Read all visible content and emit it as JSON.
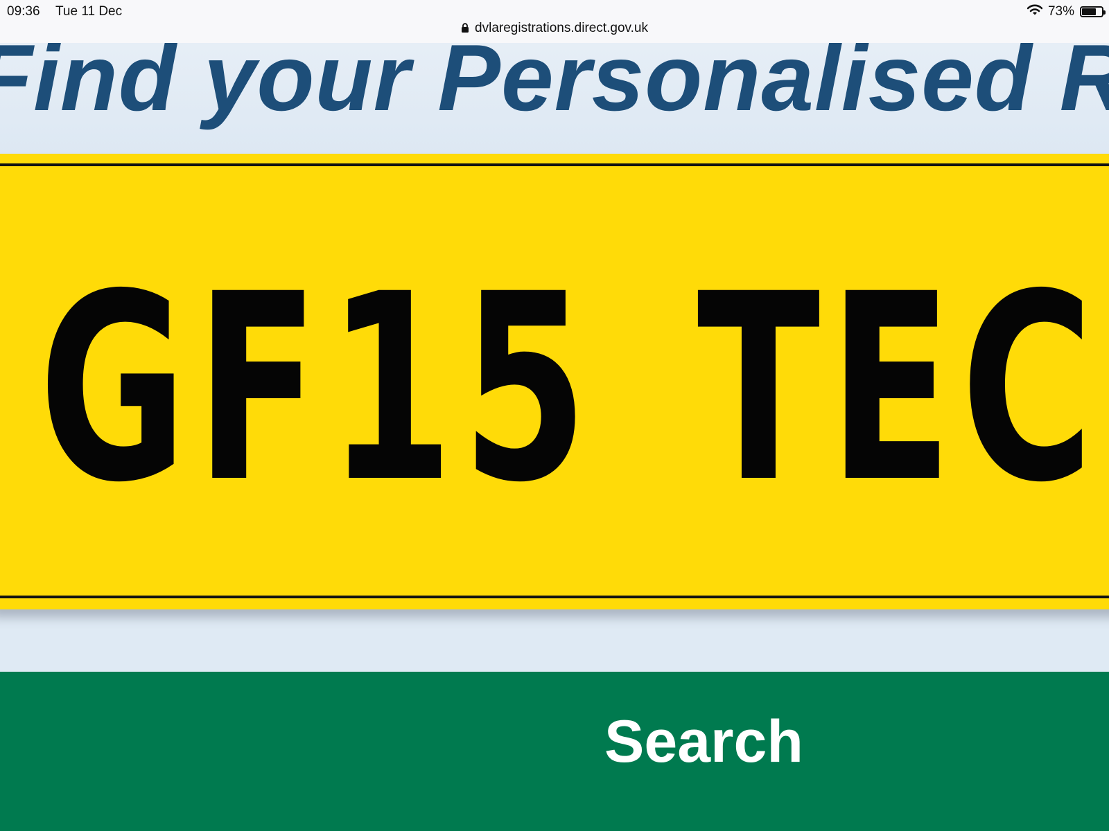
{
  "status_bar": {
    "time": "09:36",
    "date": "Tue 11 Dec",
    "battery": "73%",
    "battery_level": 0.73,
    "url": "dvlaregistrations.direct.gov.uk"
  },
  "hero": {
    "title": "Find your Personalised Reg"
  },
  "plate": {
    "registration": "GF15 TEC"
  },
  "search": {
    "button_label": "Search"
  },
  "colors": {
    "heading": "#1d4e79",
    "plate_yellow": "#ffdb08",
    "search_green": "#007a4f"
  },
  "icons": [
    "lock-icon",
    "wifi-icon",
    "battery-icon"
  ]
}
